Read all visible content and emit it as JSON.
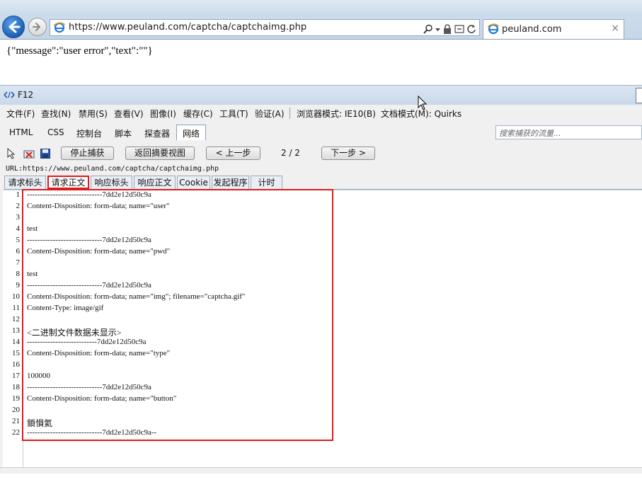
{
  "browser": {
    "url": "https://www.peuland.com/captcha/captchaimg.php",
    "tab_title": "peuland.com",
    "tab_close": "×"
  },
  "page": {
    "body_text": "{\"message\":\"user error\",\"text\":\"\"}"
  },
  "devtools": {
    "title": "F12",
    "menu": {
      "file": "文件(F)",
      "find": "查找(N)",
      "disable": "禁用(S)",
      "view": "查看(V)",
      "images": "图像(I)",
      "cache": "缓存(C)",
      "tools": "工具(T)",
      "validate": "验证(A)",
      "browser_mode": "浏览器模式: IE10(B)",
      "document_mode": "文档模式(M): Quirks"
    },
    "tabs": [
      "HTML",
      "CSS",
      "控制台",
      "脚本",
      "探查器",
      "网络"
    ],
    "search_placeholder": "搜索捕获的流量...",
    "toolbar": {
      "stop_capture": "停止捕获",
      "back_summary": "返回摘要视图",
      "prev": "< 上一步",
      "counter": "2 / 2",
      "next": "下一步 >"
    },
    "url_line": "URL:https://www.peuland.com/captcha/captchaimg.php",
    "subtabs": [
      "请求标头",
      "请求正文",
      "响应标头",
      "响应正文",
      "Cookie",
      "发起程序",
      "计时"
    ],
    "selected_subtab": "请求正文",
    "line_numbers": [
      "1",
      "2",
      "3",
      "4",
      "5",
      "6",
      "7",
      "8",
      "9",
      "10",
      "11",
      "12",
      "13",
      "14",
      "15",
      "16",
      "17",
      "18",
      "19",
      "20",
      "21",
      "22"
    ],
    "code_lines": [
      "-----------------------------7dd2e12d50c9a",
      "Content-Disposition: form-data; name=\"user\"",
      "",
      "test",
      "-----------------------------7dd2e12d50c9a",
      "Content-Disposition: form-data; name=\"pwd\"",
      "",
      "test",
      "-----------------------------7dd2e12d50c9a",
      "Content-Disposition: form-data; name=\"img\"; filename=\"captcha.gif\"",
      "Content-Type: image/gif",
      "",
      "<二进制文件数据未显示>",
      "---------------------------7dd2e12d50c9a",
      "Content-Disposition: form-data; name=\"type\"",
      "",
      "100000",
      "-----------------------------7dd2e12d50c9a",
      "Content-Disposition: form-data; name=\"button\"",
      "",
      "鎖愪氦",
      "-----------------------------7dd2e12d50c9a--"
    ]
  },
  "colors": {
    "highlight": "#e01b1b",
    "chrome_bg": "#cddceb"
  }
}
